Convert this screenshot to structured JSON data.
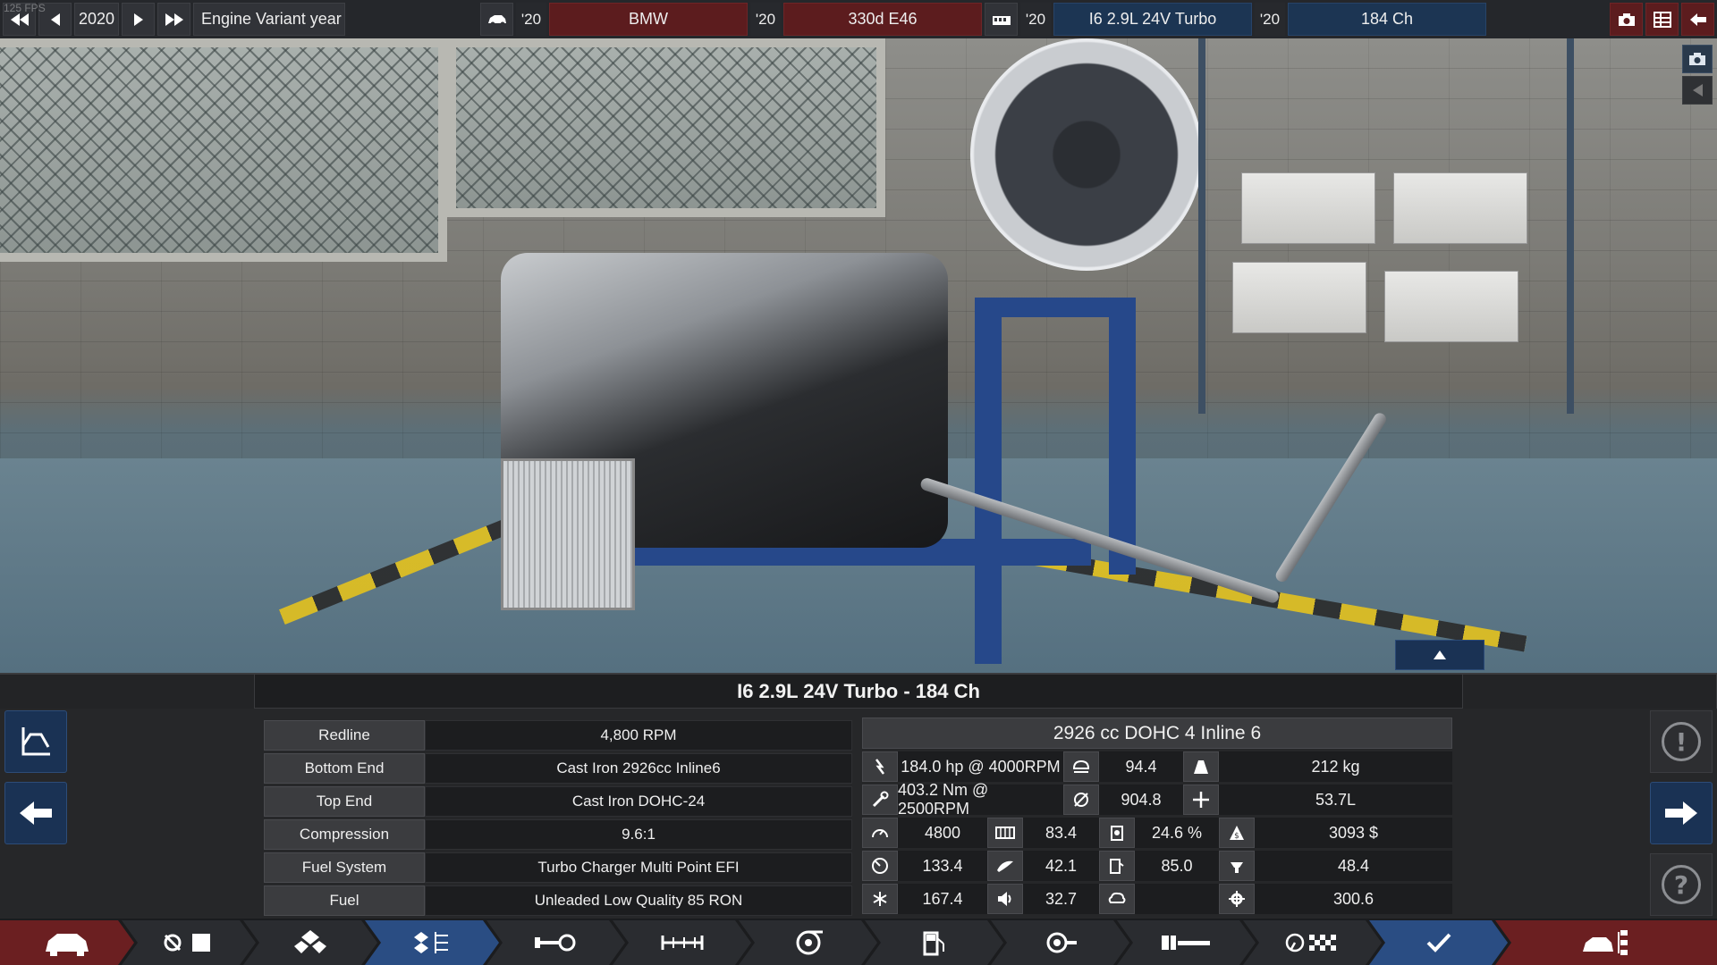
{
  "overlay": {
    "fps": "125 FPS"
  },
  "topbar": {
    "year_value": "2020",
    "year_label": "Engine Variant year",
    "car_year": "'20",
    "make": "BMW",
    "model_year": "'20",
    "model": "330d E46",
    "engine_year": "'20",
    "engine": "I6 2.9L 24V Turbo",
    "variant_year": "'20",
    "variant": "184 Ch"
  },
  "panel": {
    "title": "I6 2.9L 24V Turbo - 184 Ch",
    "specs": [
      {
        "label": "Redline",
        "value": "4,800 RPM"
      },
      {
        "label": "Bottom End",
        "value": "Cast Iron 2926cc Inline6"
      },
      {
        "label": "Top End",
        "value": "Cast Iron DOHC-24"
      },
      {
        "label": "Compression",
        "value": "9.6:1"
      },
      {
        "label": "Fuel System",
        "value": "Turbo Charger Multi Point EFI"
      },
      {
        "label": "Fuel",
        "value": "Unleaded Low Quality 85 RON"
      }
    ],
    "stats_header": "2926 cc DOHC 4  Inline 6",
    "stats": {
      "power": "184.0 hp @ 4000RPM",
      "smoothness": "94.4",
      "weight": "212 kg",
      "torque": "403.2 Nm @ 2500RPM",
      "reliability": "904.8",
      "size": "53.7L",
      "rpm": "4800",
      "responsiveness": "83.4",
      "efficiency": "24.6 %",
      "cost": "3093 $",
      "throttle": "133.4",
      "emissions_a": "42.1",
      "economy": "85.0",
      "service": "48.4",
      "cooling": "167.4",
      "loudness": "32.7",
      "emissions_b": "",
      "engineering_time": "300.6"
    }
  },
  "colors": {
    "accent_blue": "#1a3254",
    "accent_red": "#5c1c1e",
    "active_tab": "#2a4d83"
  },
  "nav": {
    "items": [
      "car-icon",
      "family-files-icon",
      "engine-family-icon",
      "engine-variant-icon",
      "bottom-end-icon",
      "top-end-icon",
      "turbo-icon",
      "fuel-icon",
      "exhaust-icon",
      "tune-icon",
      "test-icon",
      "finish-check-icon",
      "export-car-icon"
    ]
  }
}
